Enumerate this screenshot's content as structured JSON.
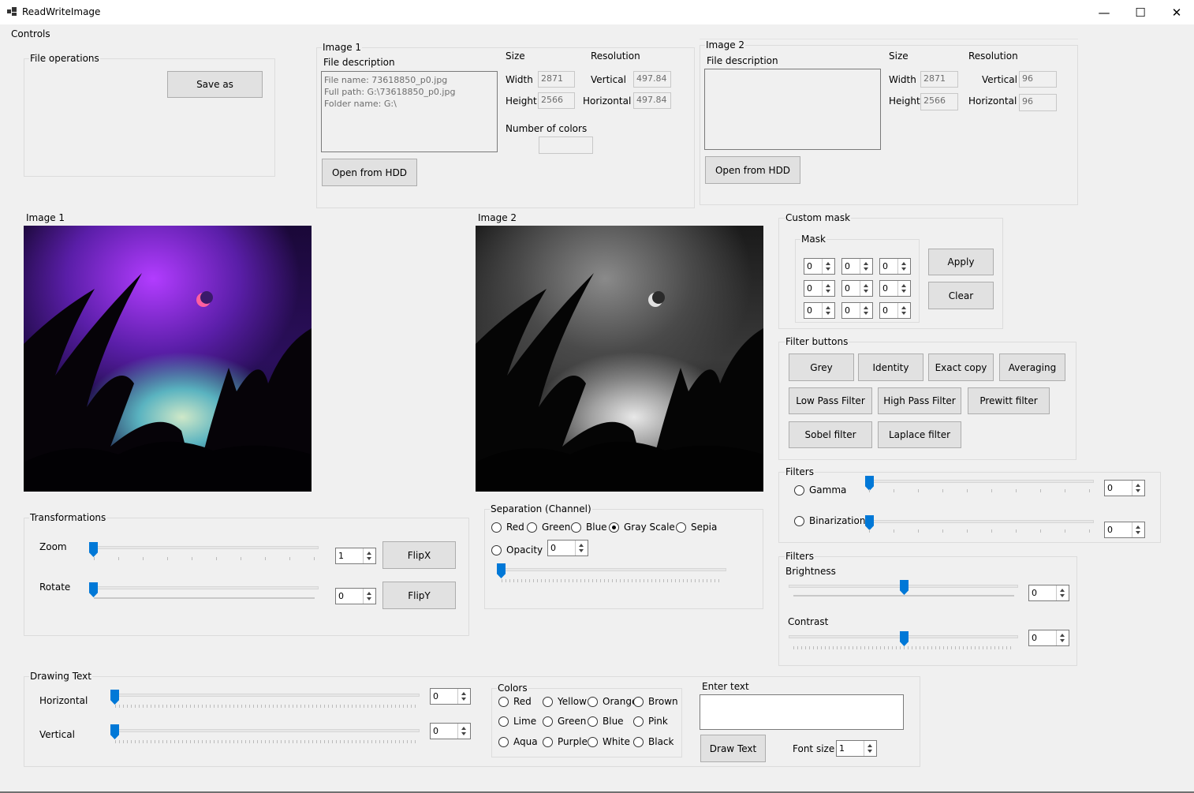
{
  "window": {
    "title": "ReadWriteImage",
    "minimize": "—",
    "maximize": "☐",
    "close": "✕"
  },
  "menu": {
    "controls": "Controls"
  },
  "file_ops": {
    "title": "File operations",
    "save_as": "Save as"
  },
  "image1_info": {
    "title": "Image 1",
    "file_description_label": "File description",
    "file_description": "File name: 73618850_p0.jpg\nFull path: G:\\73618850_p0.jpg\nFolder name: G:\\",
    "size_label": "Size",
    "width_label": "Width",
    "width": "2871",
    "height_label": "Height",
    "height": "2566",
    "resolution_label": "Resolution",
    "vertical_label": "Vertical",
    "vertical": "497.84",
    "horizontal_label": "Horizontal",
    "horizontal": "497.84",
    "num_colors_label": "Number of colors",
    "num_colors": "",
    "open_btn": "Open from HDD"
  },
  "image2_info": {
    "title": "Image 2",
    "file_description_label": "File description",
    "file_description": "",
    "size_label": "Size",
    "width_label": "Width",
    "width": "2871",
    "height_label": "Height",
    "height": "2566",
    "resolution_label": "Resolution",
    "vertical_label": "Vertical",
    "vertical": "96",
    "horizontal_label": "Horizontal",
    "horizontal": "96",
    "open_btn": "Open from HDD"
  },
  "image1_label": "Image 1",
  "image2_label": "Image 2",
  "custom_mask": {
    "title": "Custom mask",
    "mask_label": "Mask",
    "values": [
      "0",
      "0",
      "0",
      "0",
      "0",
      "0",
      "0",
      "0",
      "0"
    ],
    "apply": "Apply",
    "clear": "Clear"
  },
  "filter_buttons": {
    "title": "Filter buttons",
    "grey": "Grey",
    "identity": "Identity",
    "exact_copy": "Exact copy",
    "averaging": "Averaging",
    "low_pass": "Low Pass Filter",
    "high_pass": "High Pass Filter",
    "prewitt": "Prewitt filter",
    "sobel": "Sobel filter",
    "laplace": "Laplace filter"
  },
  "filters1": {
    "title": "Filters",
    "gamma": "Gamma",
    "gamma_value": "0",
    "binarization": "Binarization",
    "binarization_value": "0"
  },
  "filters2": {
    "title": "Filters",
    "brightness": "Brightness",
    "brightness_value": "0",
    "contrast": "Contrast",
    "contrast_value": "0"
  },
  "transformations": {
    "title": "Transformations",
    "zoom": "Zoom",
    "zoom_value": "1",
    "rotate": "Rotate",
    "rotate_value": "0",
    "flipx": "FlipX",
    "flipy": "FlipY"
  },
  "separation": {
    "title": "Separation (Channel)",
    "red": "Red",
    "green": "Green",
    "blue": "Blue",
    "gray": "Gray Scale",
    "sepia": "Sepia",
    "opacity": "Opacity",
    "opacity_value": "0",
    "selected": "Gray Scale"
  },
  "drawing_text": {
    "title": "Drawing Text",
    "horizontal": "Horizontal",
    "horizontal_value": "0",
    "vertical": "Vertical",
    "vertical_value": "0"
  },
  "colors": {
    "title": "Colors",
    "items": [
      "Red",
      "Yellow",
      "Orange",
      "Brown",
      "Lime",
      "Green",
      "Blue",
      "Pink",
      "Aqua",
      "Purple",
      "White",
      "Black"
    ]
  },
  "enter_text": {
    "label": "Enter text",
    "value": "",
    "draw_btn": "Draw Text",
    "font_size_label": "Font size",
    "font_size": "1"
  }
}
